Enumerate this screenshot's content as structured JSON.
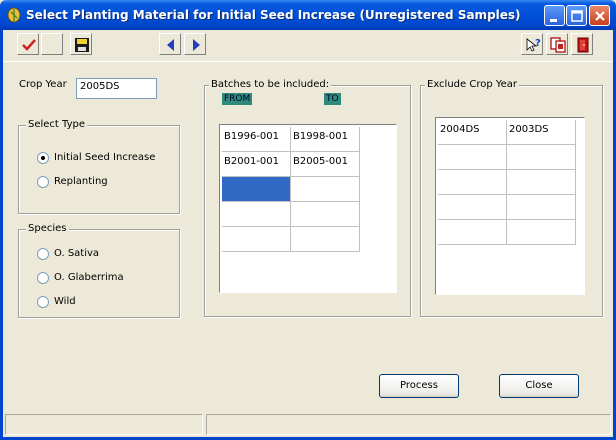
{
  "window": {
    "title": "Select Planting Material for Initial Seed Increase (Unregistered Samples)",
    "titlebar_color": "#0050D8",
    "controls": [
      "minimize-icon",
      "maximize-icon",
      "close-icon"
    ]
  },
  "toolbar": {
    "left_buttons": [
      "checkmark-icon",
      "blank-icon",
      "save-disk-icon"
    ],
    "nav_buttons": [
      "arrow-left-icon",
      "arrow-right-icon"
    ],
    "right_buttons": [
      "help-icon",
      "copy-icon",
      "exit-door-icon"
    ]
  },
  "crop_year": {
    "label": "Crop Year",
    "value": "2005DS"
  },
  "select_type": {
    "title": "Select Type",
    "options": [
      {
        "label": "Initial Seed Increase",
        "selected": true
      },
      {
        "label": "Replanting",
        "selected": false
      }
    ]
  },
  "species": {
    "title": "Species",
    "options": [
      {
        "label": "O. Sativa",
        "selected": false
      },
      {
        "label": "O. Glaberrima",
        "selected": false
      },
      {
        "label": "Wild",
        "selected": false
      }
    ]
  },
  "batches": {
    "title": "Batches to be included:",
    "from_label": "FROM",
    "to_label": "TO",
    "header_color": "#2E8B7A",
    "rows": [
      [
        "B1996-001",
        "B1998-001"
      ],
      [
        "B2001-001",
        "B2005-001"
      ],
      [
        "",
        ""
      ],
      [
        "",
        ""
      ],
      [
        "",
        ""
      ]
    ]
  },
  "exclude": {
    "title": "Exclude Crop Year",
    "rows": [
      [
        "2004DS",
        "2003DS"
      ],
      [
        "",
        ""
      ],
      [
        "",
        ""
      ],
      [
        "",
        ""
      ],
      [
        "",
        ""
      ]
    ]
  },
  "buttons": {
    "process": "Process",
    "close": "Close"
  }
}
